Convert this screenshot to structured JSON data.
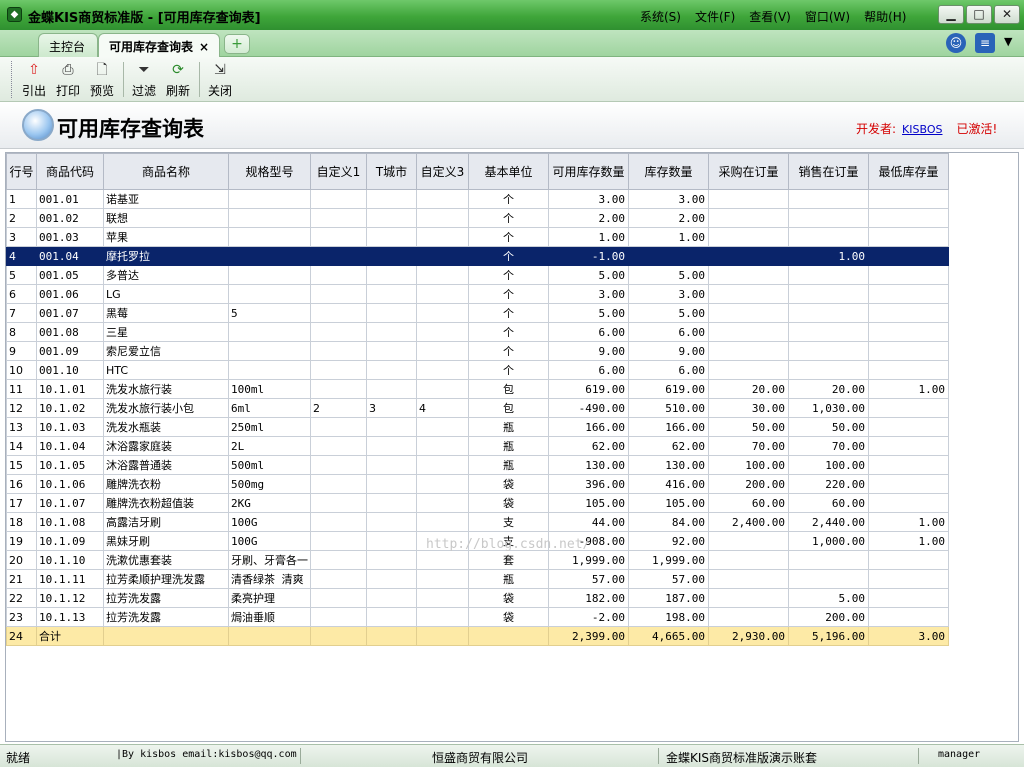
{
  "window": {
    "title": "金蝶KIS商贸标准版 - [可用库存查询表]",
    "menu": [
      "系统(S)",
      "文件(F)",
      "查看(V)",
      "窗口(W)",
      "帮助(H)"
    ]
  },
  "tabs": {
    "home": "主控台",
    "active": "可用库存查询表",
    "close_glyph": "×",
    "add_glyph": "+"
  },
  "toolbar": {
    "export": "引出",
    "print": "打印",
    "preview": "预览",
    "filter": "过滤",
    "refresh": "刷新",
    "close": "关闭"
  },
  "header": {
    "title": "可用库存查询表",
    "developer_label": "开发者:",
    "developer_link": "KISBOS",
    "status": "已激活!"
  },
  "grid": {
    "columns": [
      "行号",
      "商品代码",
      "商品名称",
      "规格型号",
      "自定义1",
      "T城市",
      "自定义3",
      "基本单位",
      "可用库存数量",
      "库存数量",
      "采购在订量",
      "销售在订量",
      "最低库存量"
    ],
    "rows": [
      [
        "1",
        "001.01",
        "诺基亚",
        "",
        "",
        "",
        "",
        "个",
        "3.00",
        "3.00",
        "",
        "",
        ""
      ],
      [
        "2",
        "001.02",
        "联想",
        "",
        "",
        "",
        "",
        "个",
        "2.00",
        "2.00",
        "",
        "",
        ""
      ],
      [
        "3",
        "001.03",
        "苹果",
        "",
        "",
        "",
        "",
        "个",
        "1.00",
        "1.00",
        "",
        "",
        ""
      ],
      [
        "4",
        "001.04",
        "摩托罗拉",
        "",
        "",
        "",
        "",
        "个",
        "-1.00",
        "",
        "",
        "1.00",
        ""
      ],
      [
        "5",
        "001.05",
        "多普达",
        "",
        "",
        "",
        "",
        "个",
        "5.00",
        "5.00",
        "",
        "",
        ""
      ],
      [
        "6",
        "001.06",
        "LG",
        "",
        "",
        "",
        "",
        "个",
        "3.00",
        "3.00",
        "",
        "",
        ""
      ],
      [
        "7",
        "001.07",
        "黑莓",
        "5",
        "",
        "",
        "",
        "个",
        "5.00",
        "5.00",
        "",
        "",
        ""
      ],
      [
        "8",
        "001.08",
        "三星",
        "",
        "",
        "",
        "",
        "个",
        "6.00",
        "6.00",
        "",
        "",
        ""
      ],
      [
        "9",
        "001.09",
        "索尼爱立信",
        "",
        "",
        "",
        "",
        "个",
        "9.00",
        "9.00",
        "",
        "",
        ""
      ],
      [
        "10",
        "001.10",
        "HTC",
        "",
        "",
        "",
        "",
        "个",
        "6.00",
        "6.00",
        "",
        "",
        ""
      ],
      [
        "11",
        "10.1.01",
        "洗发水旅行装",
        "100ml",
        "",
        "",
        "",
        "包",
        "619.00",
        "619.00",
        "20.00",
        "20.00",
        "1.00"
      ],
      [
        "12",
        "10.1.02",
        "洗发水旅行装小包",
        "6ml",
        "2",
        "3",
        "4",
        "包",
        "-490.00",
        "510.00",
        "30.00",
        "1,030.00",
        ""
      ],
      [
        "13",
        "10.1.03",
        "洗发水瓶装",
        "250ml",
        "",
        "",
        "",
        "瓶",
        "166.00",
        "166.00",
        "50.00",
        "50.00",
        ""
      ],
      [
        "14",
        "10.1.04",
        "沐浴露家庭装",
        "2L",
        "",
        "",
        "",
        "瓶",
        "62.00",
        "62.00",
        "70.00",
        "70.00",
        ""
      ],
      [
        "15",
        "10.1.05",
        "沐浴露普通装",
        "500ml",
        "",
        "",
        "",
        "瓶",
        "130.00",
        "130.00",
        "100.00",
        "100.00",
        ""
      ],
      [
        "16",
        "10.1.06",
        "雕牌洗衣粉",
        "500mg",
        "",
        "",
        "",
        "袋",
        "396.00",
        "416.00",
        "200.00",
        "220.00",
        ""
      ],
      [
        "17",
        "10.1.07",
        "雕牌洗衣粉超值装",
        "2KG",
        "",
        "",
        "",
        "袋",
        "105.00",
        "105.00",
        "60.00",
        "60.00",
        ""
      ],
      [
        "18",
        "10.1.08",
        "高露洁牙刷",
        "100G",
        "",
        "",
        "",
        "支",
        "44.00",
        "84.00",
        "2,400.00",
        "2,440.00",
        "1.00"
      ],
      [
        "19",
        "10.1.09",
        "黑妹牙刷",
        "100G",
        "",
        "",
        "",
        "支",
        "-908.00",
        "92.00",
        "",
        "1,000.00",
        "1.00"
      ],
      [
        "20",
        "10.1.10",
        "洗漱优惠套装",
        "牙刷、牙膏各一",
        "",
        "",
        "",
        "套",
        "1,999.00",
        "1,999.00",
        "",
        "",
        ""
      ],
      [
        "21",
        "10.1.11",
        "拉芳柔顺护理洗发露",
        "清香绿茶 清爽",
        "",
        "",
        "",
        "瓶",
        "57.00",
        "57.00",
        "",
        "",
        ""
      ],
      [
        "22",
        "10.1.12",
        "拉芳洗发露",
        "柔亮护理",
        "",
        "",
        "",
        "袋",
        "182.00",
        "187.00",
        "",
        "5.00",
        ""
      ],
      [
        "23",
        "10.1.13",
        "拉芳洗发露",
        "焗油垂顺",
        "",
        "",
        "",
        "袋",
        "-2.00",
        "198.00",
        "",
        "200.00",
        ""
      ]
    ],
    "selected_row": 3,
    "total": [
      "24",
      "合计",
      "",
      "",
      "",
      "",
      "",
      "",
      "2,399.00",
      "4,665.00",
      "2,930.00",
      "5,196.00",
      "3.00"
    ]
  },
  "watermark": "http://blog.csdn.net/",
  "statusbar": {
    "ready": "就绪",
    "by": "|By kisbos email:kisbos@qq.com",
    "company": "恒盛商贸有限公司",
    "account": "金蝶KIS商贸标准版演示账套",
    "user": "manager"
  },
  "colors": {
    "selected_row_bg": "#0a246a",
    "total_row_bg": "#fdeaa6",
    "accent_green": "#3fa63a",
    "developer_red": "#d40000"
  }
}
